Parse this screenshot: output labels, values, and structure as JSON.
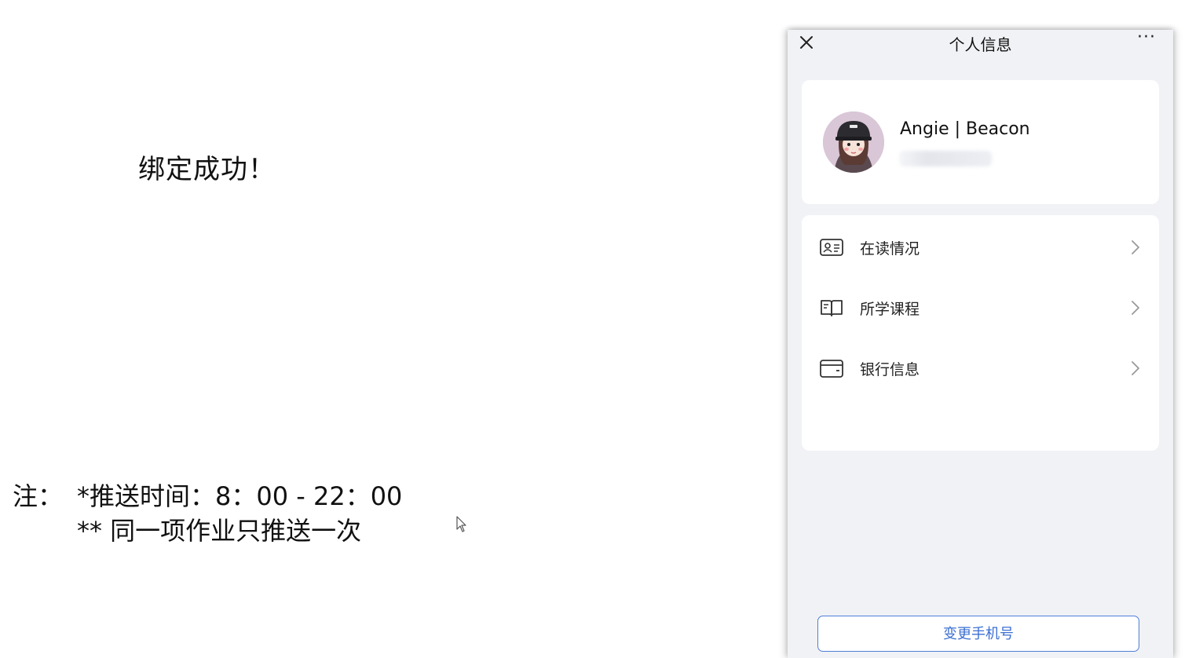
{
  "left_panel": {
    "success_message": "绑定成功！",
    "note_prefix": "注：",
    "note_line1": "*推送时间：8：00 - 22：00",
    "note_line2": "** 同一项作业只推送一次"
  },
  "phone": {
    "title": "个人信息",
    "more_label": "···",
    "profile": {
      "name": "Angie | Beacon"
    },
    "menu": [
      {
        "label": "在读情况",
        "icon": "id-card-icon"
      },
      {
        "label": "所学课程",
        "icon": "book-icon"
      },
      {
        "label": "银行信息",
        "icon": "wallet-icon"
      }
    ],
    "change_phone_button": "变更手机号"
  },
  "colors": {
    "phone_background": "#f1f2f6",
    "card_background": "#ffffff",
    "accent_blue": "#3c6fd3"
  }
}
